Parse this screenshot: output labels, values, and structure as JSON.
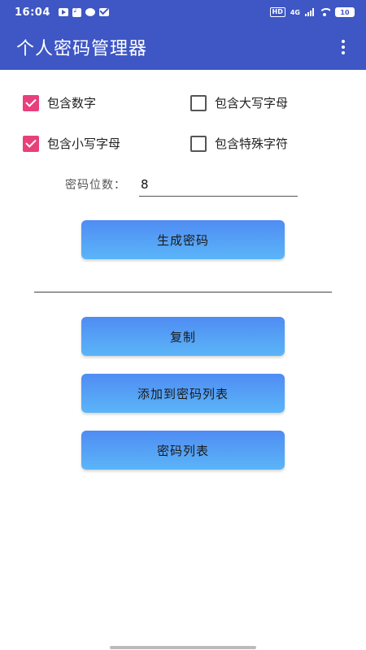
{
  "status_bar": {
    "time": "16:04",
    "hd": "HD",
    "network": "4G",
    "battery": "10"
  },
  "app_bar": {
    "title": "个人密码管理器"
  },
  "options": {
    "digits": {
      "label": "包含数字",
      "checked": true
    },
    "uppercase": {
      "label": "包含大写字母",
      "checked": false
    },
    "lowercase": {
      "label": "包含小写字母",
      "checked": true
    },
    "special": {
      "label": "包含特殊字符",
      "checked": false
    }
  },
  "length": {
    "label": "密码位数：",
    "value": "8"
  },
  "buttons": {
    "generate": "生成密码",
    "copy": "复制",
    "add_to_list": "添加到密码列表",
    "list": "密码列表"
  },
  "colors": {
    "primary": "#3e57c5",
    "accent": "#e8407b",
    "button_top": "#4f8cf3",
    "button_bottom": "#5bb5f8"
  }
}
